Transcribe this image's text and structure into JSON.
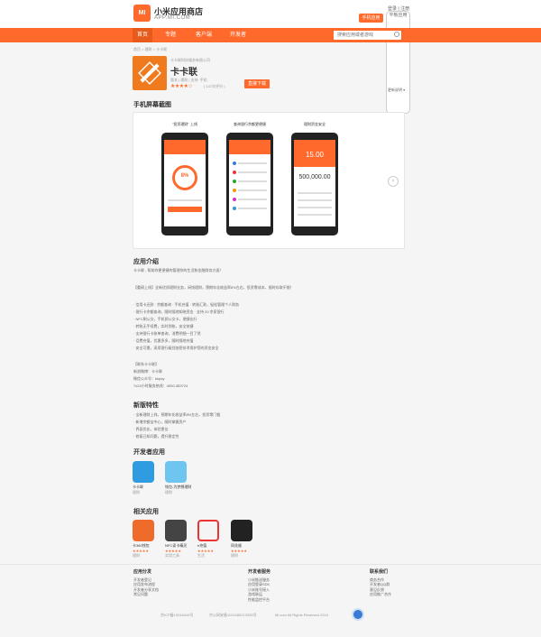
{
  "header": {
    "logo_text": "MI",
    "site_title": "小米应用商店",
    "site_sub": "APP.MI.COM",
    "login": "登录 | 注册",
    "pc_button": "手机应用",
    "phone_button": "平板应用"
  },
  "nav": {
    "items": [
      "首页",
      "专题",
      "客户端",
      "开发者"
    ],
    "search_placeholder": "搜索应用或者游戏"
  },
  "breadcrumb": "首页 > 理财 > 卡卡联",
  "app": {
    "developer": "卡卡联科技服务有限公司",
    "name": "卡卡联",
    "meta": "版本 | 理财 | 支持: 手机",
    "stars": "★★★★☆",
    "rating_count": "( 147次评分 )",
    "install": "直接下载",
    "more_versions": "更新说明 ▾"
  },
  "screenshots": {
    "title": "手机屏幕截图",
    "captions": [
      "\"投资理财\" 上线",
      "查询银行余额更便捷",
      "理财资金安全"
    ],
    "ring_value": "8%",
    "big_value": "15.00",
    "dark_value": "500,000.00"
  },
  "intro": {
    "title": "应用介绍",
    "lines": [
      "卡卡联 - 帮助你更便捷的管理你的生活和金融财务方面！",
      "【重磅上线】全新优质理财业务，闲钱理财，预期年化收益率8%左右，投资零成本，随时存取不限！",
      "· 信用卡还款 · 余额查询 · 手机充值 · 转账汇款，轻松管理个人财务",
      "· 银行卡余额查询，随时随地知晓资金 · 支持 20 余家银行",
      "· NFC刷公交，手机即公交卡，便捷出行",
      "· 转账无手续费，实时到账，安全快捷",
      "· 支持银行卡账单查询，消费明细一目了然",
      "· 话费充值，优惠多多，随时随地充值",
      "· 安全可靠，采用银行级别加密技术保护您的资金安全",
      "【联系卡卡联】",
      "新浪微博：卡卡联",
      "微信公众号：kkpay",
      "7x24小时服务热线：4000-383724"
    ]
  },
  "features": {
    "title": "新版特性",
    "lines": [
      "· 全新理财上线，预期年化收益率8%左右，投资零门槛",
      "· 新增余额宝中心，随时掌握资产",
      "· 界面优化，体验更佳",
      "· 修复已知问题，提升稳定性"
    ]
  },
  "dev_apps": {
    "title": "开发者应用",
    "items": [
      {
        "name": "卡卡联",
        "cat": "理财",
        "color": "#2f9be0"
      },
      {
        "name": "钱包-为梦想理财",
        "cat": "理财",
        "color": "#6ec6f0"
      }
    ]
  },
  "related": {
    "title": "相关应用",
    "items": [
      {
        "name": "卡360钱包",
        "cat": "理财",
        "color": "#ef6b2c"
      },
      {
        "name": "NFC读卡精灵",
        "cat": "实用工具",
        "color": "#444444"
      },
      {
        "name": "e充值",
        "cat": "生活",
        "color": "#f4f4f4"
      },
      {
        "name": "同花顺",
        "cat": "理财",
        "color": "#222222"
      }
    ]
  },
  "footer": {
    "col1_head": "应用分发",
    "col1": [
      "开发者登记",
      "应用发布流程",
      "开发者分享文档",
      "常见问题"
    ],
    "col2_head": "开发者服务",
    "col2": [
      "小米推送服务",
      "应用登录SDK",
      "小米账号接入",
      "游戏联运",
      "性能监控平台"
    ],
    "col3_head": "联系我们",
    "col3": [
      "商务合作",
      "开发者QQ群",
      "意见反馈",
      "应用推广合作"
    ],
    "copyright1": "京ICP备10046444号",
    "copyright2": "京公网安备1101080212535号",
    "copyright3": "Mi.com All Rights Reserved 2016"
  },
  "colors": {
    "accent": "#ff6a2c"
  }
}
